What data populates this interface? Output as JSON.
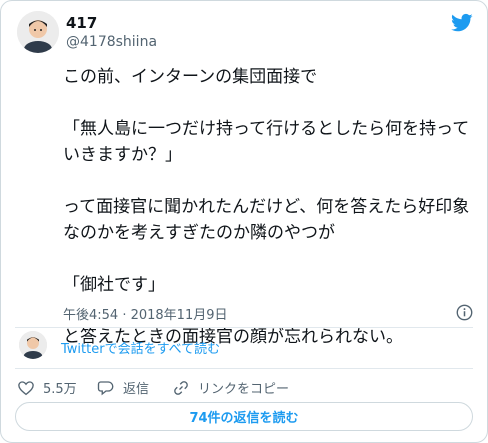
{
  "user": {
    "name": "417",
    "handle": "@4178shiina"
  },
  "tweet": {
    "lines": [
      "この前、インターンの集団面接で",
      "",
      "「無人島に一つだけ持って行けるとしたら何を持っていきますか？」",
      "",
      "って面接官に聞かれたんだけど、何を答えたら好印象なのかを考えすぎたのか隣のやつが",
      "",
      "「御社です」",
      "",
      "と答えたときの面接官の顔が忘れられない。"
    ],
    "timestamp": "午後4:54 · 2018年11月9日"
  },
  "thread": {
    "link_label": "Twitterで会話をすべて読む"
  },
  "actions": {
    "like_count": "5.5万",
    "reply_label": "返信",
    "copy_link_label": "リンクをコピー"
  },
  "replies": {
    "button_label": "74件の返信を読む"
  },
  "colors": {
    "accent": "#1d9bf0",
    "secondary_text": "#536471",
    "border": "#cfd9de"
  },
  "icons": [
    "twitter-bird-icon",
    "info-icon",
    "heart-icon",
    "reply-icon",
    "link-icon"
  ]
}
